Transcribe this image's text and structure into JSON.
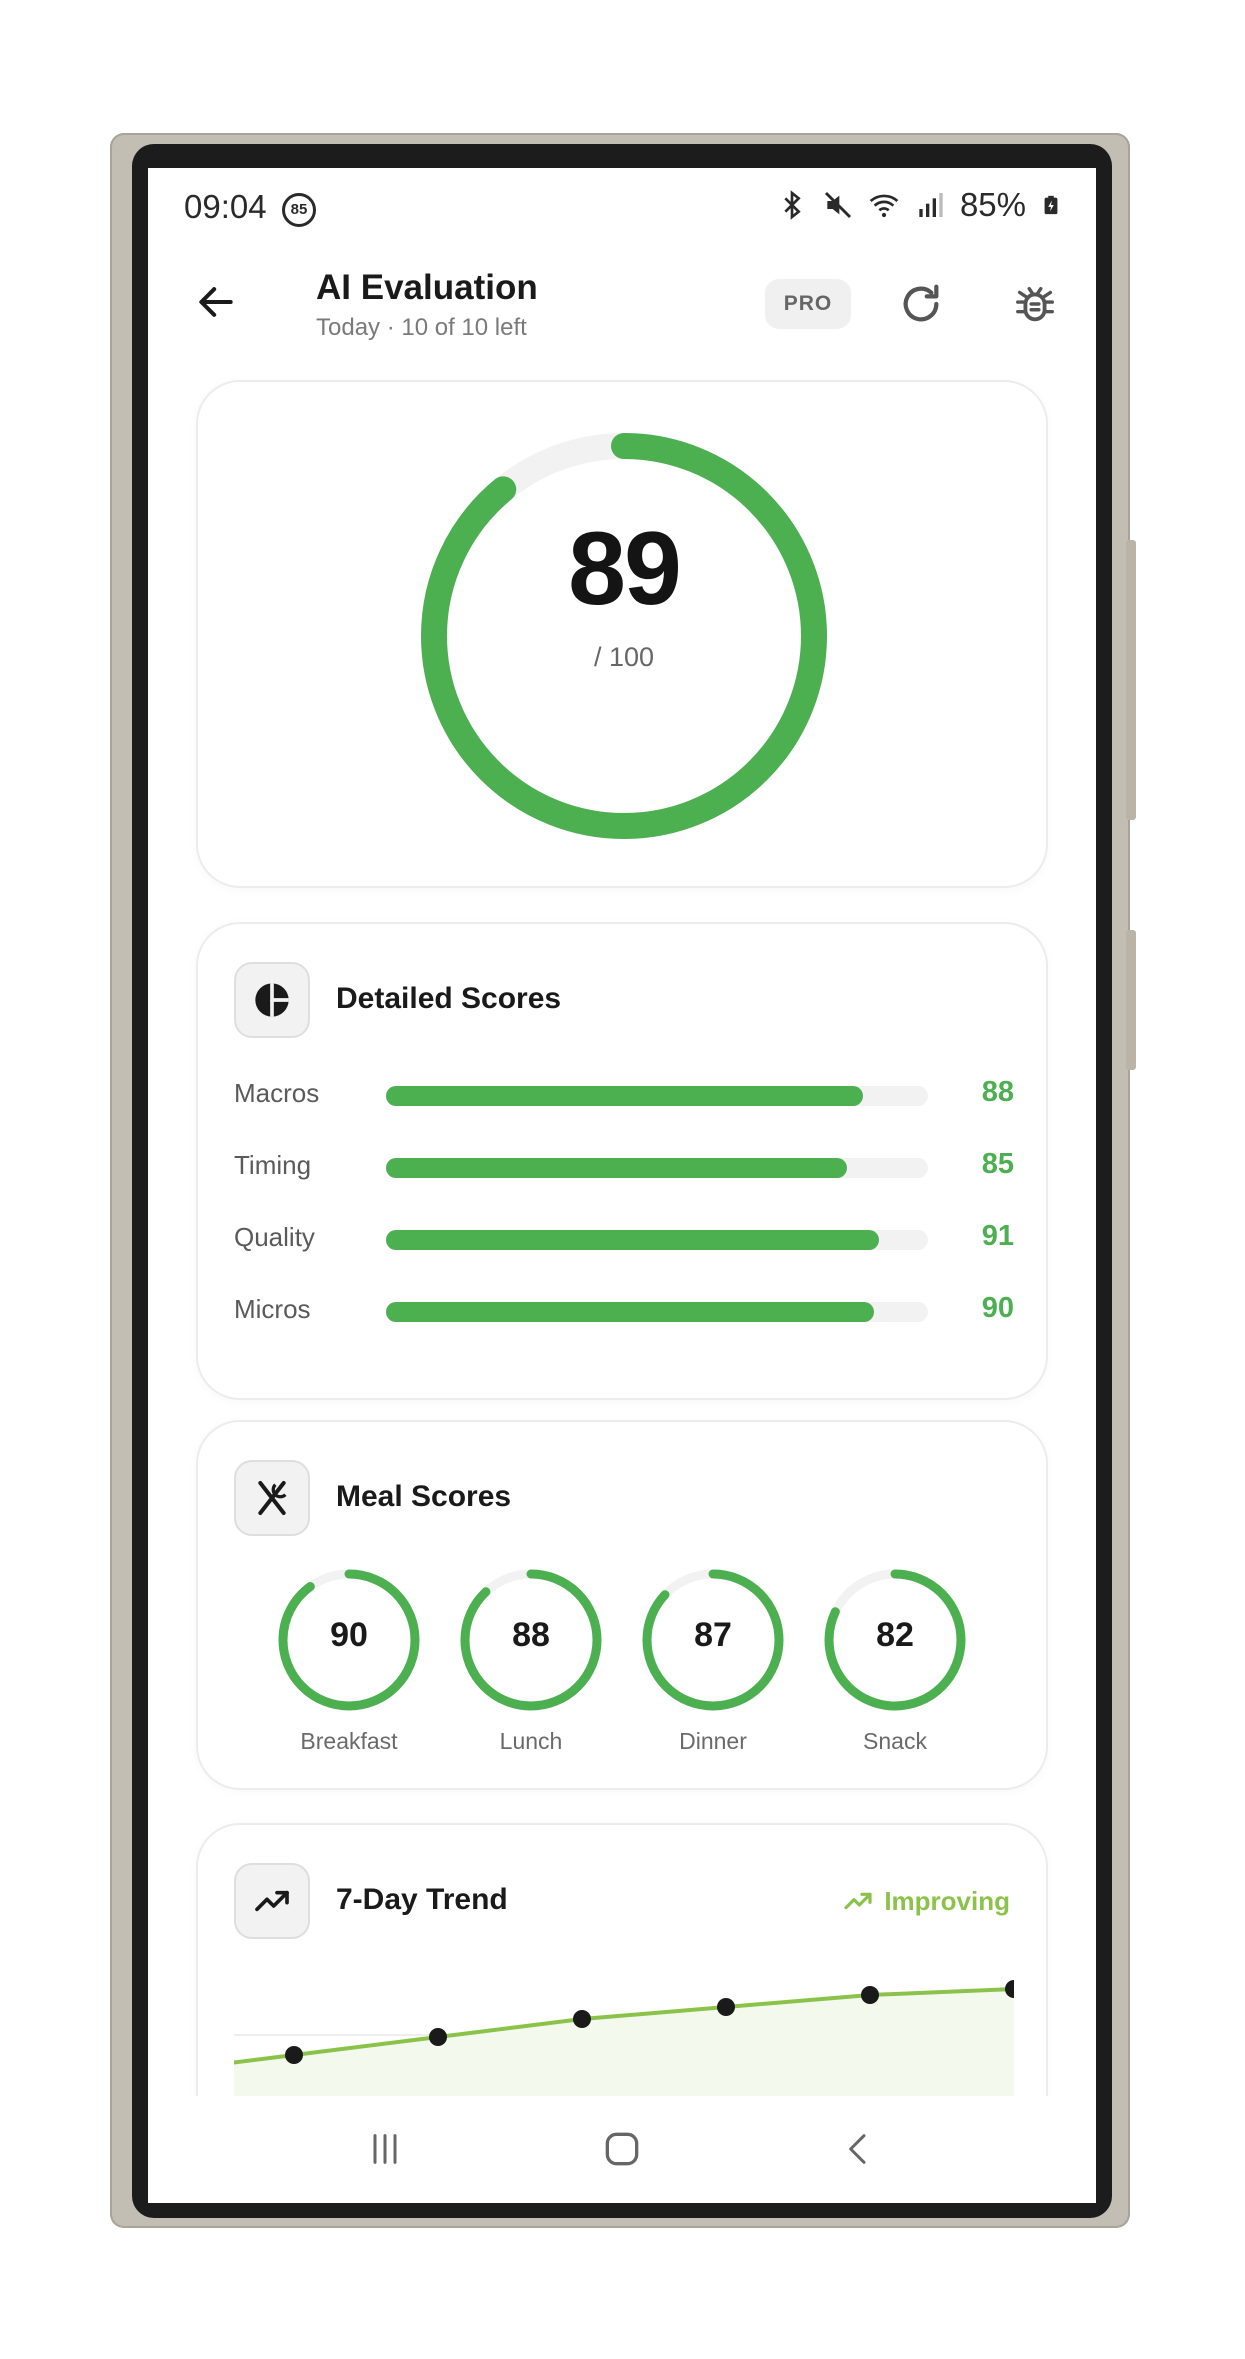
{
  "status_bar": {
    "time": "09:04",
    "notification_badge": "85",
    "battery_percent": "85%",
    "icons": [
      "bluetooth-icon",
      "mute-icon",
      "wifi-icon",
      "signal-icon",
      "battery-charging-icon"
    ]
  },
  "header": {
    "title": "AI Evaluation",
    "subtitle": "Today · 10 of 10 left",
    "pro_label": "PRO",
    "icons": [
      "back-arrow-icon",
      "refresh-icon",
      "bug-icon"
    ]
  },
  "overall": {
    "score": "89",
    "max_label": "/ 100",
    "fraction": 0.89
  },
  "detailed": {
    "title": "Detailed Scores",
    "icon": "pie-chart-icon",
    "rows": [
      {
        "label": "Macros",
        "value": "88",
        "fraction": 0.88
      },
      {
        "label": "Timing",
        "value": "85",
        "fraction": 0.85
      },
      {
        "label": "Quality",
        "value": "91",
        "fraction": 0.91
      },
      {
        "label": "Micros",
        "value": "90",
        "fraction": 0.9
      }
    ]
  },
  "meals": {
    "title": "Meal Scores",
    "icon": "utensils-icon",
    "items": [
      {
        "label": "Breakfast",
        "value": "90",
        "fraction": 0.9
      },
      {
        "label": "Lunch",
        "value": "88",
        "fraction": 0.88
      },
      {
        "label": "Dinner",
        "value": "87",
        "fraction": 0.87
      },
      {
        "label": "Snack",
        "value": "82",
        "fraction": 0.82
      }
    ]
  },
  "trend": {
    "title": "7-Day Trend",
    "icon": "trending-up-icon",
    "status": "Improving",
    "status_icon": "trending-up-icon"
  },
  "chart_data": {
    "type": "line",
    "x": [
      1,
      2,
      3,
      4,
      5,
      6,
      7
    ],
    "series": [
      {
        "values": [
          82,
          83.5,
          85,
          86.5,
          87.5,
          88.5,
          89
        ]
      }
    ],
    "ylim": [
      80,
      91
    ],
    "grid": true,
    "title": "7-Day Trend",
    "xlabel": "",
    "ylabel": ""
  },
  "colors": {
    "accent_green": "#4caf50",
    "trend_green": "#8bc34a",
    "track_grey": "#f2f2f2"
  },
  "nav": {
    "icons": [
      "recent-apps-icon",
      "home-icon",
      "back-nav-icon"
    ]
  }
}
